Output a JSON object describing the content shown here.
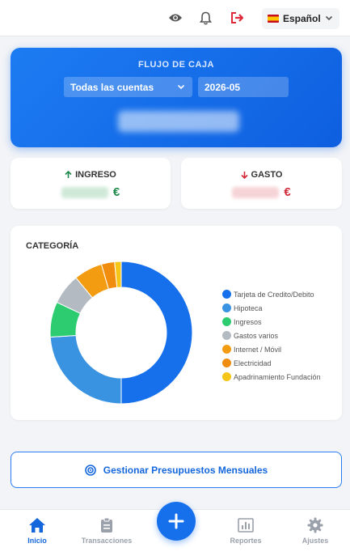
{
  "topbar": {
    "icons": [
      "eye-icon",
      "bell-icon",
      "logout-icon"
    ],
    "language": "Español"
  },
  "cashflow": {
    "title": "FLUJO DE CAJA",
    "account_select": "Todas las cuentas",
    "month_select": "2026-05"
  },
  "income": {
    "label": "INGRESO",
    "currency": "€",
    "color": "#1f8a4c"
  },
  "expense": {
    "label": "GASTO",
    "currency": "€",
    "color": "#d12b3a"
  },
  "category": {
    "title": "CATEGORÍA",
    "chart_data": {
      "type": "pie",
      "categories": [
        "Tarjeta de Credito/Debito",
        "Hipoteca",
        "Ingresos",
        "Gastos varios",
        "Internet / Móvil",
        "Electricidad",
        "Apadrinamiento Fundación"
      ],
      "values": [
        50,
        24,
        8,
        7,
        6.5,
        3,
        1.5
      ],
      "colors": [
        "#1670ec",
        "#3a93e0",
        "#2ecc71",
        "#b3bac2",
        "#f39c12",
        "#f08c0e",
        "#f5c518"
      ],
      "legend_position": "right"
    }
  },
  "budget_button": {
    "label": "Gestionar Presupuestos Mensuales"
  },
  "bottom_nav": {
    "items": [
      "Inicio",
      "Transacciones",
      "Reportes",
      "Ajustes"
    ],
    "active": "Inicio"
  }
}
